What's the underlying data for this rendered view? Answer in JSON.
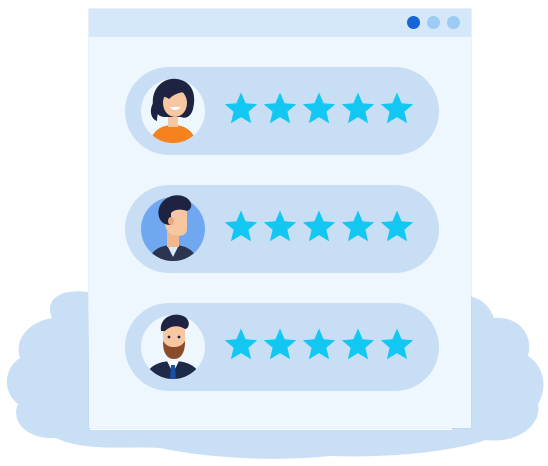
{
  "colors": {
    "background": "#ffffff",
    "blob": "#c8dff5",
    "window": "#eef6fe",
    "titlebar": "#d5e8fa",
    "row": "#c7def5",
    "star": "#12c8f2",
    "dot_active": "#1565d8",
    "dot_inactive": "#9ccbf4"
  },
  "window": {
    "dots": [
      {
        "name": "window-dot-1",
        "color": "#1565d8"
      },
      {
        "name": "window-dot-2",
        "color": "#9ccbf4"
      },
      {
        "name": "window-dot-3",
        "color": "#9ccbf4"
      }
    ]
  },
  "reviews": [
    {
      "avatar": "woman-avatar-icon",
      "rating": 5,
      "max": 5
    },
    {
      "avatar": "man-avatar-icon",
      "rating": 5,
      "max": 5
    },
    {
      "avatar": "bearded-man-avatar-icon",
      "rating": 5,
      "max": 5
    }
  ]
}
